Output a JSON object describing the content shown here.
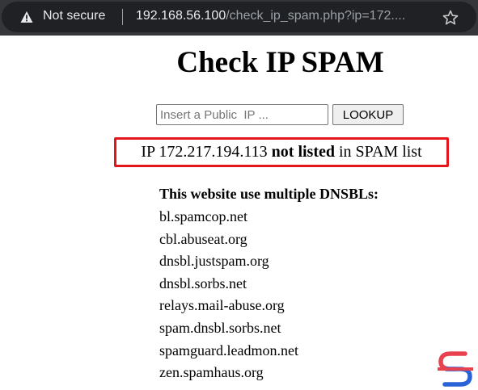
{
  "browser": {
    "security_label": "Not secure",
    "url_host": "192.168.56.100",
    "url_path": "/check_ip_spam.php?ip=172....",
    "icons": {
      "security": "warning-icon",
      "bookmark": "star-icon"
    }
  },
  "page": {
    "title": "Check IP SPAM",
    "search": {
      "placeholder": "Insert a Public  IP ...",
      "value": ""
    },
    "lookup_label": "LOOKUP",
    "result": {
      "prefix": "IP 172.217.194.113 ",
      "status": "not listed",
      "suffix": " in SPAM list",
      "border_color": "#e5161b"
    },
    "dnsbl_heading": "This website use multiple DNSBLs:",
    "dnsbls": [
      "bl.spamcop.net",
      "cbl.abuseat.org",
      "dnsbl.justspam.org",
      "dnsbl.sorbs.net",
      "relays.mail-abuse.org",
      "spam.dnsbl.sorbs.net",
      "spamguard.leadmon.net",
      "zen.spamhaus.org"
    ]
  },
  "colors": {
    "browser_bar": "#35363a",
    "omnibox": "#202124",
    "logo_red": "#e8424f",
    "logo_blue": "#2a63d8"
  }
}
